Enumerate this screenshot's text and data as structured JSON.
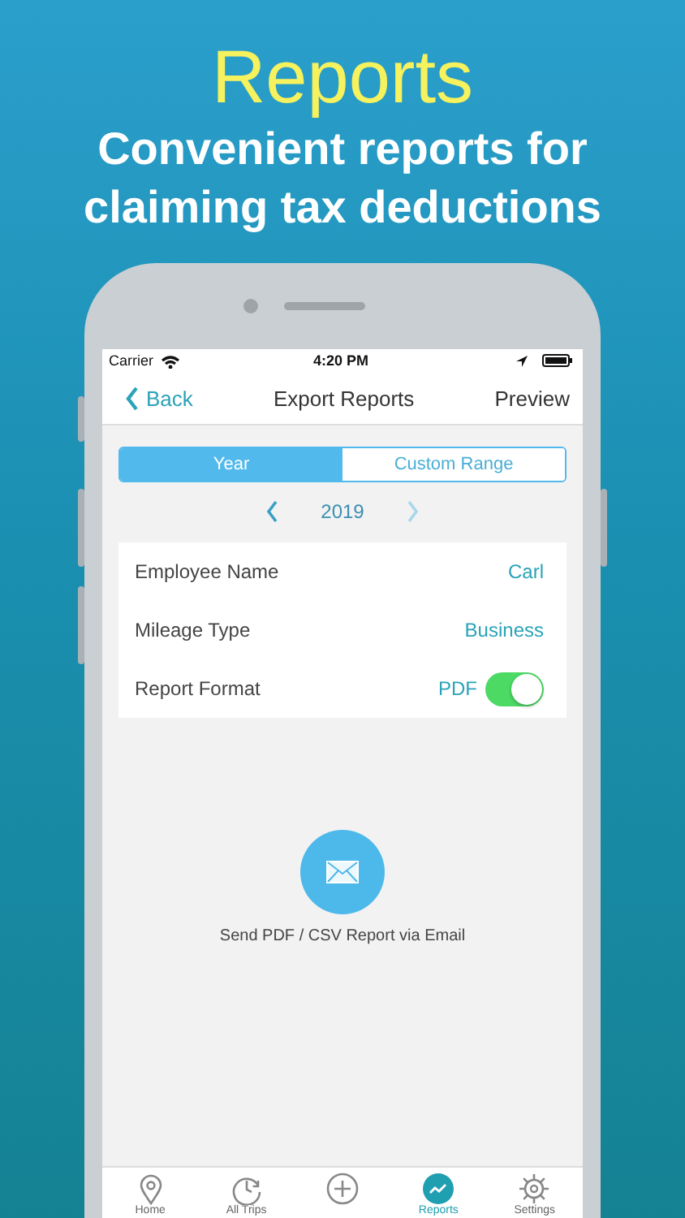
{
  "header": {
    "title": "Reports",
    "subtitle_lines": [
      "Convenient reports for",
      "claiming tax deductions"
    ]
  },
  "status_bar": {
    "carrier": "Carrier",
    "time": "4:20 PM"
  },
  "nav": {
    "back": "Back",
    "title": "Export Reports",
    "action": "Preview"
  },
  "segments": [
    {
      "label": "Year",
      "selected": true
    },
    {
      "label": "Custom Range",
      "selected": false
    }
  ],
  "year_picker": {
    "year": "2019",
    "next_disabled": true
  },
  "settings": [
    {
      "kind": "text",
      "label": "Employee Name",
      "value": "Carl"
    },
    {
      "kind": "text",
      "label": "Mileage Type",
      "value": "Business"
    },
    {
      "kind": "toggle",
      "label": "Report Format",
      "value": "PDF",
      "on": true
    }
  ],
  "email": {
    "label": "Send PDF / CSV Report via Email"
  },
  "tab_bar": [
    {
      "kind": "pin",
      "label": "Home",
      "selected": false
    },
    {
      "kind": "clock",
      "label": "All Trips",
      "selected": false
    },
    {
      "kind": "add",
      "selected": false
    },
    {
      "kind": "chart",
      "label": "Reports",
      "selected": true
    },
    {
      "kind": "gear",
      "label": "Settings",
      "selected": false
    }
  ]
}
